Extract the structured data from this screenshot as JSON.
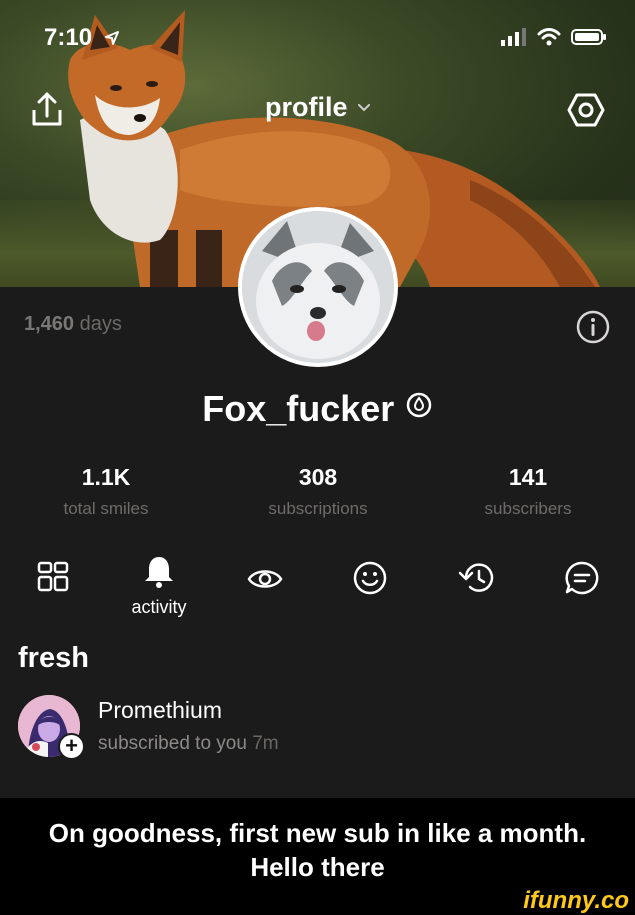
{
  "status_bar": {
    "time": "7:10"
  },
  "header": {
    "title": "profile"
  },
  "profile": {
    "days_count": "1,460",
    "days_label": "days",
    "username": "Fox_fucker",
    "stats": [
      {
        "value": "1.1K",
        "label": "total smiles"
      },
      {
        "value": "308",
        "label": "subscriptions"
      },
      {
        "value": "141",
        "label": "subscribers"
      }
    ]
  },
  "tabs": {
    "active_label": "activity",
    "items": [
      "grid-icon",
      "bell-icon",
      "eye-icon",
      "smile-icon",
      "history-icon",
      "comment-icon"
    ]
  },
  "feed": {
    "section_title": "fresh",
    "items": [
      {
        "name": "Promethium",
        "action": "subscribed to you",
        "time": "7m"
      }
    ]
  },
  "caption": {
    "line1": "On goodness, first new sub in like a month.",
    "line2": "Hello there"
  },
  "watermark": "ifunny.co",
  "colors": {
    "background": "#1c1b1b",
    "accent": "#ffc91a"
  }
}
